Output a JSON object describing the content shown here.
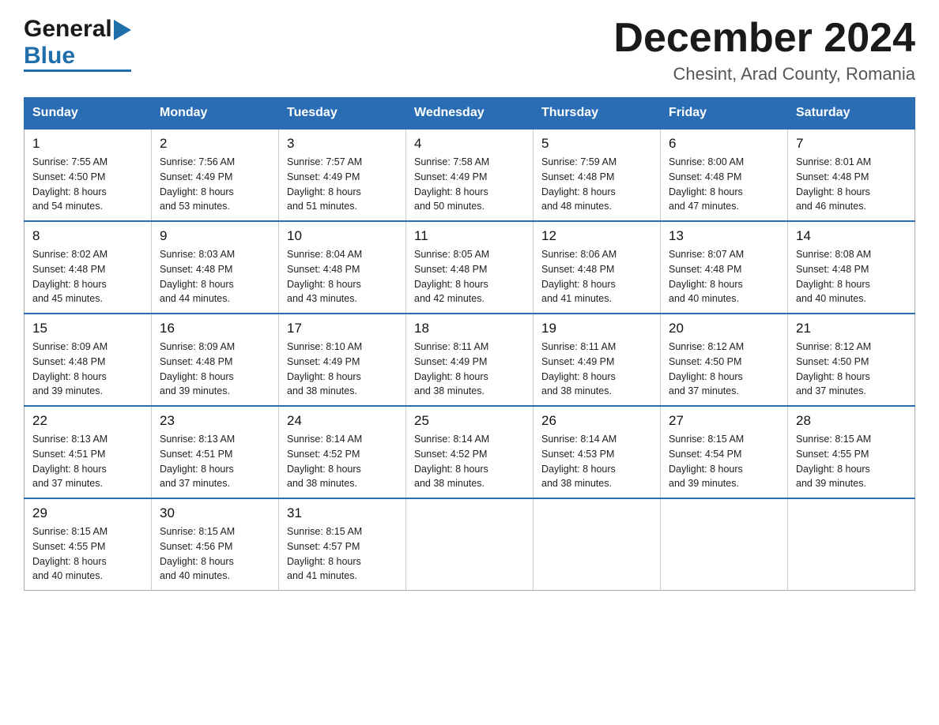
{
  "logo": {
    "general": "General",
    "blue": "Blue",
    "arrow": "▶"
  },
  "title": {
    "month_year": "December 2024",
    "location": "Chesint, Arad County, Romania"
  },
  "headers": [
    "Sunday",
    "Monday",
    "Tuesday",
    "Wednesday",
    "Thursday",
    "Friday",
    "Saturday"
  ],
  "weeks": [
    [
      {
        "day": "1",
        "sunrise": "Sunrise: 7:55 AM",
        "sunset": "Sunset: 4:50 PM",
        "daylight": "Daylight: 8 hours",
        "minutes": "and 54 minutes."
      },
      {
        "day": "2",
        "sunrise": "Sunrise: 7:56 AM",
        "sunset": "Sunset: 4:49 PM",
        "daylight": "Daylight: 8 hours",
        "minutes": "and 53 minutes."
      },
      {
        "day": "3",
        "sunrise": "Sunrise: 7:57 AM",
        "sunset": "Sunset: 4:49 PM",
        "daylight": "Daylight: 8 hours",
        "minutes": "and 51 minutes."
      },
      {
        "day": "4",
        "sunrise": "Sunrise: 7:58 AM",
        "sunset": "Sunset: 4:49 PM",
        "daylight": "Daylight: 8 hours",
        "minutes": "and 50 minutes."
      },
      {
        "day": "5",
        "sunrise": "Sunrise: 7:59 AM",
        "sunset": "Sunset: 4:48 PM",
        "daylight": "Daylight: 8 hours",
        "minutes": "and 48 minutes."
      },
      {
        "day": "6",
        "sunrise": "Sunrise: 8:00 AM",
        "sunset": "Sunset: 4:48 PM",
        "daylight": "Daylight: 8 hours",
        "minutes": "and 47 minutes."
      },
      {
        "day": "7",
        "sunrise": "Sunrise: 8:01 AM",
        "sunset": "Sunset: 4:48 PM",
        "daylight": "Daylight: 8 hours",
        "minutes": "and 46 minutes."
      }
    ],
    [
      {
        "day": "8",
        "sunrise": "Sunrise: 8:02 AM",
        "sunset": "Sunset: 4:48 PM",
        "daylight": "Daylight: 8 hours",
        "minutes": "and 45 minutes."
      },
      {
        "day": "9",
        "sunrise": "Sunrise: 8:03 AM",
        "sunset": "Sunset: 4:48 PM",
        "daylight": "Daylight: 8 hours",
        "minutes": "and 44 minutes."
      },
      {
        "day": "10",
        "sunrise": "Sunrise: 8:04 AM",
        "sunset": "Sunset: 4:48 PM",
        "daylight": "Daylight: 8 hours",
        "minutes": "and 43 minutes."
      },
      {
        "day": "11",
        "sunrise": "Sunrise: 8:05 AM",
        "sunset": "Sunset: 4:48 PM",
        "daylight": "Daylight: 8 hours",
        "minutes": "and 42 minutes."
      },
      {
        "day": "12",
        "sunrise": "Sunrise: 8:06 AM",
        "sunset": "Sunset: 4:48 PM",
        "daylight": "Daylight: 8 hours",
        "minutes": "and 41 minutes."
      },
      {
        "day": "13",
        "sunrise": "Sunrise: 8:07 AM",
        "sunset": "Sunset: 4:48 PM",
        "daylight": "Daylight: 8 hours",
        "minutes": "and 40 minutes."
      },
      {
        "day": "14",
        "sunrise": "Sunrise: 8:08 AM",
        "sunset": "Sunset: 4:48 PM",
        "daylight": "Daylight: 8 hours",
        "minutes": "and 40 minutes."
      }
    ],
    [
      {
        "day": "15",
        "sunrise": "Sunrise: 8:09 AM",
        "sunset": "Sunset: 4:48 PM",
        "daylight": "Daylight: 8 hours",
        "minutes": "and 39 minutes."
      },
      {
        "day": "16",
        "sunrise": "Sunrise: 8:09 AM",
        "sunset": "Sunset: 4:48 PM",
        "daylight": "Daylight: 8 hours",
        "minutes": "and 39 minutes."
      },
      {
        "day": "17",
        "sunrise": "Sunrise: 8:10 AM",
        "sunset": "Sunset: 4:49 PM",
        "daylight": "Daylight: 8 hours",
        "minutes": "and 38 minutes."
      },
      {
        "day": "18",
        "sunrise": "Sunrise: 8:11 AM",
        "sunset": "Sunset: 4:49 PM",
        "daylight": "Daylight: 8 hours",
        "minutes": "and 38 minutes."
      },
      {
        "day": "19",
        "sunrise": "Sunrise: 8:11 AM",
        "sunset": "Sunset: 4:49 PM",
        "daylight": "Daylight: 8 hours",
        "minutes": "and 38 minutes."
      },
      {
        "day": "20",
        "sunrise": "Sunrise: 8:12 AM",
        "sunset": "Sunset: 4:50 PM",
        "daylight": "Daylight: 8 hours",
        "minutes": "and 37 minutes."
      },
      {
        "day": "21",
        "sunrise": "Sunrise: 8:12 AM",
        "sunset": "Sunset: 4:50 PM",
        "daylight": "Daylight: 8 hours",
        "minutes": "and 37 minutes."
      }
    ],
    [
      {
        "day": "22",
        "sunrise": "Sunrise: 8:13 AM",
        "sunset": "Sunset: 4:51 PM",
        "daylight": "Daylight: 8 hours",
        "minutes": "and 37 minutes."
      },
      {
        "day": "23",
        "sunrise": "Sunrise: 8:13 AM",
        "sunset": "Sunset: 4:51 PM",
        "daylight": "Daylight: 8 hours",
        "minutes": "and 37 minutes."
      },
      {
        "day": "24",
        "sunrise": "Sunrise: 8:14 AM",
        "sunset": "Sunset: 4:52 PM",
        "daylight": "Daylight: 8 hours",
        "minutes": "and 38 minutes."
      },
      {
        "day": "25",
        "sunrise": "Sunrise: 8:14 AM",
        "sunset": "Sunset: 4:52 PM",
        "daylight": "Daylight: 8 hours",
        "minutes": "and 38 minutes."
      },
      {
        "day": "26",
        "sunrise": "Sunrise: 8:14 AM",
        "sunset": "Sunset: 4:53 PM",
        "daylight": "Daylight: 8 hours",
        "minutes": "and 38 minutes."
      },
      {
        "day": "27",
        "sunrise": "Sunrise: 8:15 AM",
        "sunset": "Sunset: 4:54 PM",
        "daylight": "Daylight: 8 hours",
        "minutes": "and 39 minutes."
      },
      {
        "day": "28",
        "sunrise": "Sunrise: 8:15 AM",
        "sunset": "Sunset: 4:55 PM",
        "daylight": "Daylight: 8 hours",
        "minutes": "and 39 minutes."
      }
    ],
    [
      {
        "day": "29",
        "sunrise": "Sunrise: 8:15 AM",
        "sunset": "Sunset: 4:55 PM",
        "daylight": "Daylight: 8 hours",
        "minutes": "and 40 minutes."
      },
      {
        "day": "30",
        "sunrise": "Sunrise: 8:15 AM",
        "sunset": "Sunset: 4:56 PM",
        "daylight": "Daylight: 8 hours",
        "minutes": "and 40 minutes."
      },
      {
        "day": "31",
        "sunrise": "Sunrise: 8:15 AM",
        "sunset": "Sunset: 4:57 PM",
        "daylight": "Daylight: 8 hours",
        "minutes": "and 41 minutes."
      },
      null,
      null,
      null,
      null
    ]
  ]
}
